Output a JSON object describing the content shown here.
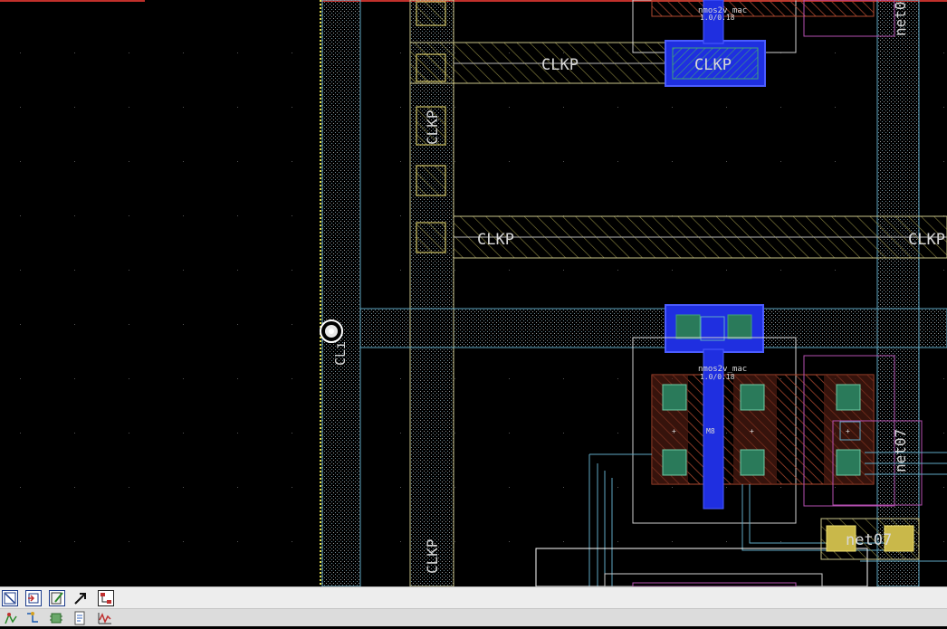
{
  "layout_labels": {
    "clkp": "CLKP",
    "cl_pin": "CLı",
    "net07": "net07",
    "net0_top": "net0",
    "device_name": "nmos2v_mac",
    "device_size": "1.0/0.18",
    "instance": "M8"
  },
  "colors": {
    "metal1": "#d4cf54",
    "poly": "#1f2fe0",
    "diffusion": "#7a2a1a",
    "contact": "#2a7a5a",
    "metal2": "#5fa9c4",
    "nwell": "#b44fb0",
    "pin_marker": "#ffffff",
    "title_border": "#c0302b"
  },
  "toolbar": {
    "row1_icons": [
      "zoom-fit-icon",
      "zoom-in-icon",
      "edit-properties-icon",
      "stretch-icon",
      "hierarchy-icon"
    ],
    "row2_icons": [
      "create-path-icon",
      "wire-icon",
      "instance-icon",
      "report-icon",
      "waveform-icon"
    ]
  }
}
